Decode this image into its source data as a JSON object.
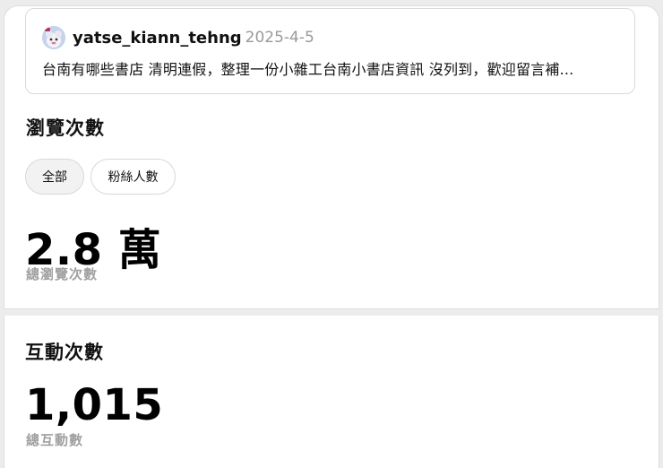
{
  "post": {
    "username": "yatse_kiann_tehng",
    "date": "2025-4-5",
    "text": "台南有哪些書店 清明連假，整理一份小雜工台南小書店資訊 沒列到，歡迎留言補...",
    "avatar_icon": "avatar-icon"
  },
  "views": {
    "title": "瀏覽次數",
    "filters": [
      {
        "label": "全部",
        "active": true
      },
      {
        "label": "粉絲人數",
        "active": false
      }
    ],
    "value": "2.8 萬",
    "label": "總瀏覽次數"
  },
  "interactions": {
    "title": "互動次數",
    "value": "1,015",
    "label": "總互動數"
  },
  "colors": {
    "background": "#ececec",
    "card": "#ffffff",
    "muted_text": "#a0a0a0",
    "date_text": "#999999"
  }
}
